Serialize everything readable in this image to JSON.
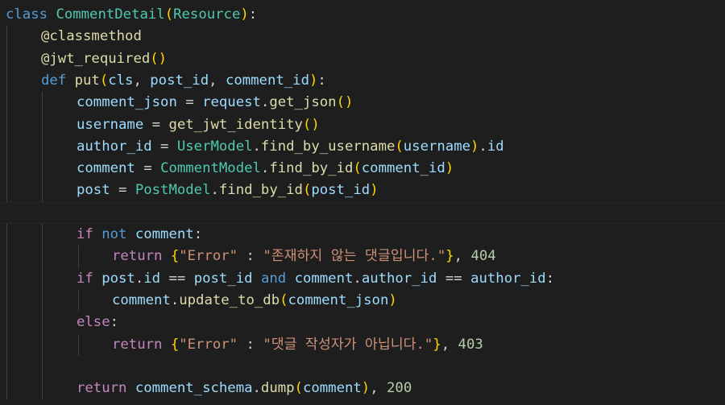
{
  "editor": {
    "language": "python",
    "colors": {
      "background": "#1e1e1e",
      "keyword": "#569cd6",
      "control": "#c586c0",
      "class": "#4ec9b0",
      "function": "#dcdcaa",
      "variable": "#9cdcfe",
      "string": "#ce9178",
      "number": "#b5cea8",
      "bracket1": "#ffd700",
      "bracket2": "#da70d6"
    },
    "lines": [
      [
        [
          "kw",
          "class"
        ],
        [
          "pun",
          " "
        ],
        [
          "cls",
          "CommentDetail"
        ],
        [
          "b1",
          "("
        ],
        [
          "cls",
          "Resource"
        ],
        [
          "b1",
          ")"
        ],
        [
          "pun",
          ":"
        ]
      ],
      [
        [
          "fn",
          "@classmethod"
        ]
      ],
      [
        [
          "fn",
          "@jwt_required"
        ],
        [
          "b1",
          "()"
        ]
      ],
      [
        [
          "kw",
          "def"
        ],
        [
          "pun",
          " "
        ],
        [
          "fn",
          "put"
        ],
        [
          "b1",
          "("
        ],
        [
          "var",
          "cls"
        ],
        [
          "pun",
          ", "
        ],
        [
          "var",
          "post_id"
        ],
        [
          "pun",
          ", "
        ],
        [
          "var",
          "comment_id"
        ],
        [
          "b1",
          ")"
        ],
        [
          "pun",
          ":"
        ]
      ],
      [
        [
          "var",
          "comment_json"
        ],
        [
          "pun",
          " = "
        ],
        [
          "var",
          "request"
        ],
        [
          "pun",
          "."
        ],
        [
          "fn",
          "get_json"
        ],
        [
          "b1",
          "()"
        ]
      ],
      [
        [
          "var",
          "username"
        ],
        [
          "pun",
          " = "
        ],
        [
          "fn",
          "get_jwt_identity"
        ],
        [
          "b1",
          "()"
        ]
      ],
      [
        [
          "var",
          "author_id"
        ],
        [
          "pun",
          " = "
        ],
        [
          "cls",
          "UserModel"
        ],
        [
          "pun",
          "."
        ],
        [
          "fn",
          "find_by_username"
        ],
        [
          "b1",
          "("
        ],
        [
          "var",
          "username"
        ],
        [
          "b1",
          ")"
        ],
        [
          "pun",
          "."
        ],
        [
          "var",
          "id"
        ]
      ],
      [
        [
          "var",
          "comment"
        ],
        [
          "pun",
          " = "
        ],
        [
          "cls",
          "CommentModel"
        ],
        [
          "pun",
          "."
        ],
        [
          "fn",
          "find_by_id"
        ],
        [
          "b1",
          "("
        ],
        [
          "var",
          "comment_id"
        ],
        [
          "b1",
          ")"
        ]
      ],
      [
        [
          "var",
          "post"
        ],
        [
          "pun",
          " = "
        ],
        [
          "cls",
          "PostModel"
        ],
        [
          "pun",
          "."
        ],
        [
          "fn",
          "find_by_id"
        ],
        [
          "b1",
          "("
        ],
        [
          "var",
          "post_id"
        ],
        [
          "b1",
          ")"
        ]
      ],
      [],
      [
        [
          "ctl",
          "if"
        ],
        [
          "pun",
          " "
        ],
        [
          "kw",
          "not"
        ],
        [
          "pun",
          " "
        ],
        [
          "var",
          "comment"
        ],
        [
          "pun",
          ":"
        ]
      ],
      [
        [
          "ctl",
          "return"
        ],
        [
          "pun",
          " "
        ],
        [
          "b1",
          "{"
        ],
        [
          "str",
          "\"Error\""
        ],
        [
          "pun",
          " : "
        ],
        [
          "str",
          "\"존재하지 않는 댓글입니다.\""
        ],
        [
          "b1",
          "}"
        ],
        [
          "pun",
          ", "
        ],
        [
          "num",
          "404"
        ]
      ],
      [
        [
          "ctl",
          "if"
        ],
        [
          "pun",
          " "
        ],
        [
          "var",
          "post"
        ],
        [
          "pun",
          "."
        ],
        [
          "var",
          "id"
        ],
        [
          "pun",
          " == "
        ],
        [
          "var",
          "post_id"
        ],
        [
          "pun",
          " "
        ],
        [
          "kw",
          "and"
        ],
        [
          "pun",
          " "
        ],
        [
          "var",
          "comment"
        ],
        [
          "pun",
          "."
        ],
        [
          "var",
          "author_id"
        ],
        [
          "pun",
          " == "
        ],
        [
          "var",
          "author_id"
        ],
        [
          "pun",
          ":"
        ]
      ],
      [
        [
          "var",
          "comment"
        ],
        [
          "pun",
          "."
        ],
        [
          "fn",
          "update_to_db"
        ],
        [
          "b1",
          "("
        ],
        [
          "var",
          "comment_json"
        ],
        [
          "b1",
          ")"
        ]
      ],
      [
        [
          "ctl",
          "else"
        ],
        [
          "pun",
          ":"
        ]
      ],
      [
        [
          "ctl",
          "return"
        ],
        [
          "pun",
          " "
        ],
        [
          "b1",
          "{"
        ],
        [
          "str",
          "\"Error\""
        ],
        [
          "pun",
          " : "
        ],
        [
          "str",
          "\"댓글 작성자가 아닙니다.\""
        ],
        [
          "b1",
          "}"
        ],
        [
          "pun",
          ", "
        ],
        [
          "num",
          "403"
        ]
      ],
      [],
      [
        [
          "ctl",
          "return"
        ],
        [
          "pun",
          " "
        ],
        [
          "var",
          "comment_schema"
        ],
        [
          "pun",
          "."
        ],
        [
          "fn",
          "dump"
        ],
        [
          "b1",
          "("
        ],
        [
          "var",
          "comment"
        ],
        [
          "b1",
          ")"
        ],
        [
          "pun",
          ", "
        ],
        [
          "num",
          "200"
        ]
      ]
    ]
  }
}
